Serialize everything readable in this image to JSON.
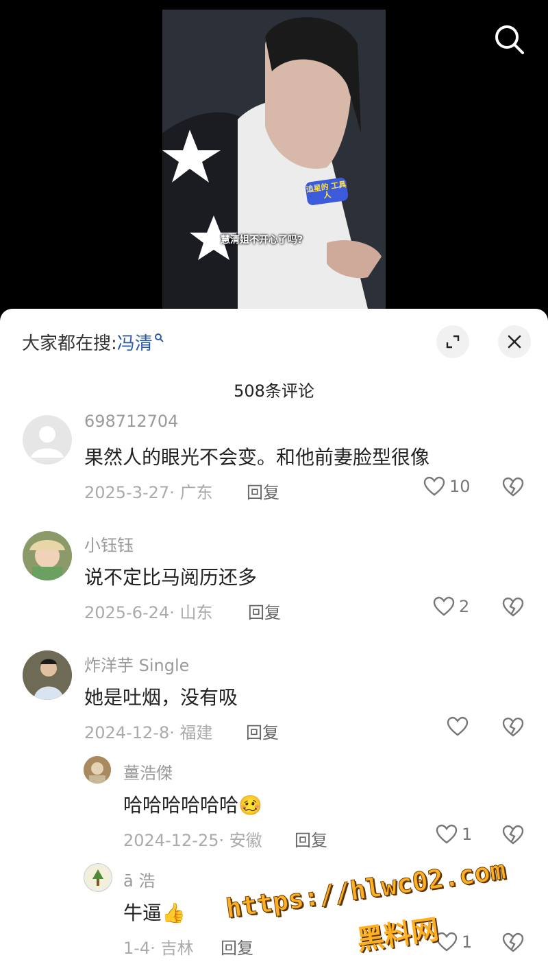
{
  "video": {
    "caption": "慧清姐不开心了吗?",
    "badge": "追星的 工具人"
  },
  "header": {
    "search_prefix": "大家都在搜:",
    "search_keyword": "冯清",
    "comment_count": "508条评论"
  },
  "comments": [
    {
      "username": "698712704",
      "text": "果然人的眼光不会变。和他前妻脸型很像",
      "date": "2025-3-27",
      "location": "广东",
      "reply_label": "回复",
      "likes": "10"
    },
    {
      "username": "小钰钰",
      "text": "说不定比马阅历还多",
      "date": "2025-6-24",
      "location": "山东",
      "reply_label": "回复",
      "likes": "2"
    },
    {
      "username": "炸洋芋 Single",
      "text": "她是吐烟，没有吸",
      "date": "2024-12-8",
      "location": "福建",
      "reply_label": "回复",
      "likes": ""
    }
  ],
  "replies": [
    {
      "username": "薑浩傑",
      "text": "哈哈哈哈哈哈🥴",
      "date": "2024-12-25",
      "location": "安徽",
      "reply_label": "回复",
      "likes": "1"
    },
    {
      "username": "ā 浩",
      "text": "牛逼👍",
      "date": "1-4",
      "location": "吉林",
      "reply_label": "回复",
      "likes": "1"
    }
  ],
  "watermark": {
    "url": "https://hlwc02.com",
    "site": "黑料网"
  },
  "icons": {
    "search": "search-icon",
    "expand": "expand-icon",
    "close": "close-icon",
    "like": "heart-icon",
    "dislike": "broken-heart-icon"
  }
}
